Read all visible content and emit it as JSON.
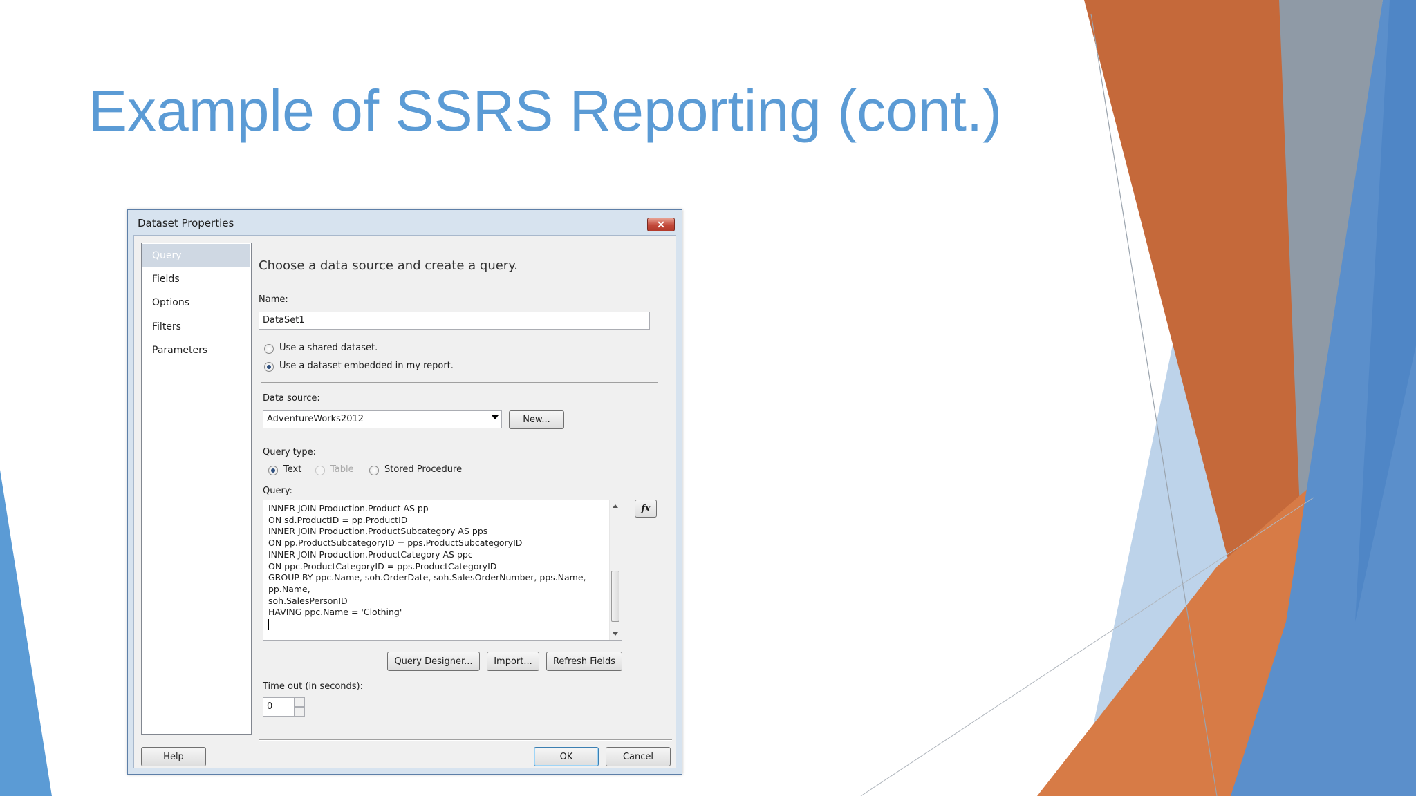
{
  "slide": {
    "title": "Example of SSRS Reporting (cont.)",
    "colors": {
      "title": "#5b9bd5",
      "orange": "#c55a11",
      "blue": "#5b9bd5"
    }
  },
  "dialog": {
    "title": "Dataset Properties",
    "close_icon": "close-icon",
    "nav": [
      {
        "label": "Query",
        "selected": true
      },
      {
        "label": "Fields",
        "selected": false
      },
      {
        "label": "Options",
        "selected": false
      },
      {
        "label": "Filters",
        "selected": false
      },
      {
        "label": "Parameters",
        "selected": false
      }
    ],
    "heading": "Choose a data source and create a query.",
    "name_label": "Name:",
    "name_value": "DataSet1",
    "dataset_options": [
      {
        "label": "Use a shared dataset.",
        "checked": false
      },
      {
        "label": "Use a dataset embedded in my report.",
        "checked": true
      }
    ],
    "data_source_label": "Data source:",
    "data_source_value": "AdventureWorks2012",
    "new_button": "New...",
    "query_type_label": "Query type:",
    "query_types": [
      {
        "label": "Text",
        "checked": true,
        "disabled": false
      },
      {
        "label": "Table",
        "checked": false,
        "disabled": true
      },
      {
        "label": "Stored Procedure",
        "checked": false,
        "disabled": false
      }
    ],
    "query_label": "Query:",
    "query_lines": [
      "INNER JOIN Production.Product AS pp",
      "ON sd.ProductID = pp.ProductID",
      "INNER JOIN Production.ProductSubcategory AS pps",
      "ON pp.ProductSubcategoryID = pps.ProductSubcategoryID",
      "INNER JOIN Production.ProductCategory AS ppc",
      "ON ppc.ProductCategoryID = pps.ProductCategoryID",
      "GROUP BY ppc.Name, soh.OrderDate, soh.SalesOrderNumber, pps.Name,",
      "pp.Name,",
      "soh.SalesPersonID",
      "HAVING ppc.Name = 'Clothing'"
    ],
    "fx_button": "fx",
    "query_designer_button": "Query Designer...",
    "import_button": "Import...",
    "refresh_fields_button": "Refresh Fields",
    "timeout_label": "Time out (in seconds):",
    "timeout_value": "0",
    "help_button": "Help",
    "ok_button": "OK",
    "cancel_button": "Cancel"
  }
}
